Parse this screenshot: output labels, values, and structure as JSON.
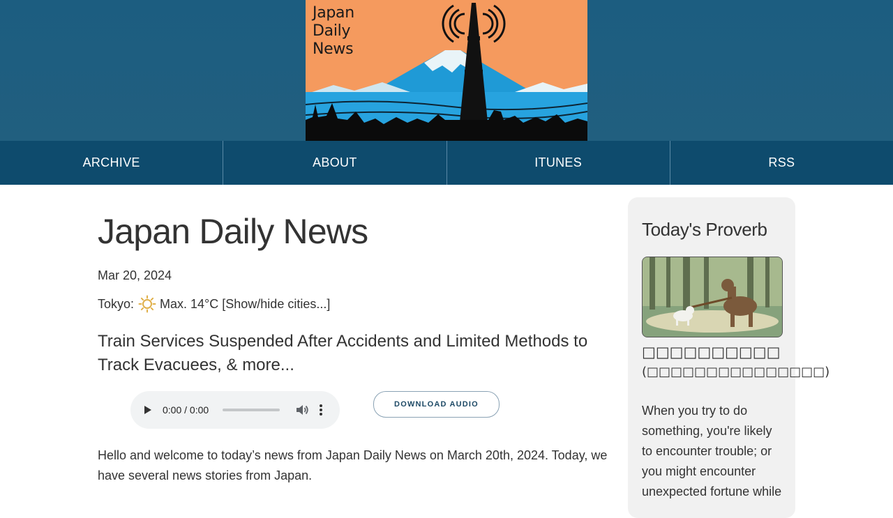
{
  "banner": {
    "logo_text": "Japan\nDaily\nNews"
  },
  "nav": {
    "items": [
      {
        "label": "ARCHIVE"
      },
      {
        "label": "ABOUT"
      },
      {
        "label": "ITUNES"
      },
      {
        "label": "RSS"
      }
    ]
  },
  "main": {
    "title": "Japan Daily News",
    "date": "Mar 20, 2024",
    "weather": {
      "city": "Tokyo:",
      "icon": "sun-icon",
      "max_temp": "Max. 14°C",
      "toggle_label": "[Show/hide cities...]"
    },
    "headline": "Train Services Suspended After Accidents and Limited Methods to Track Evacuees, & more...",
    "player": {
      "time": "0:00 / 0:00"
    },
    "download_label": "DOWNLOAD AUDIO",
    "intro": "Hello and welcome to today’s news from Japan Daily News on March 20th, 2024. Today, we have several news stories from Japan."
  },
  "sidebar": {
    "title": "Today's Proverb",
    "proverb_jp": "□□□□□□□□□□",
    "proverb_reading": "(□□□□□□□□□□□□□□□)",
    "meaning": "When you try to do something, you're likely to encounter trouble; or you might encounter unexpected fortune while"
  },
  "colors": {
    "header_bg": "#1c5d80",
    "nav_bg": "#0e4b6d",
    "sidebar_bg": "#f1f1f1",
    "button_text": "#1e4a66"
  }
}
